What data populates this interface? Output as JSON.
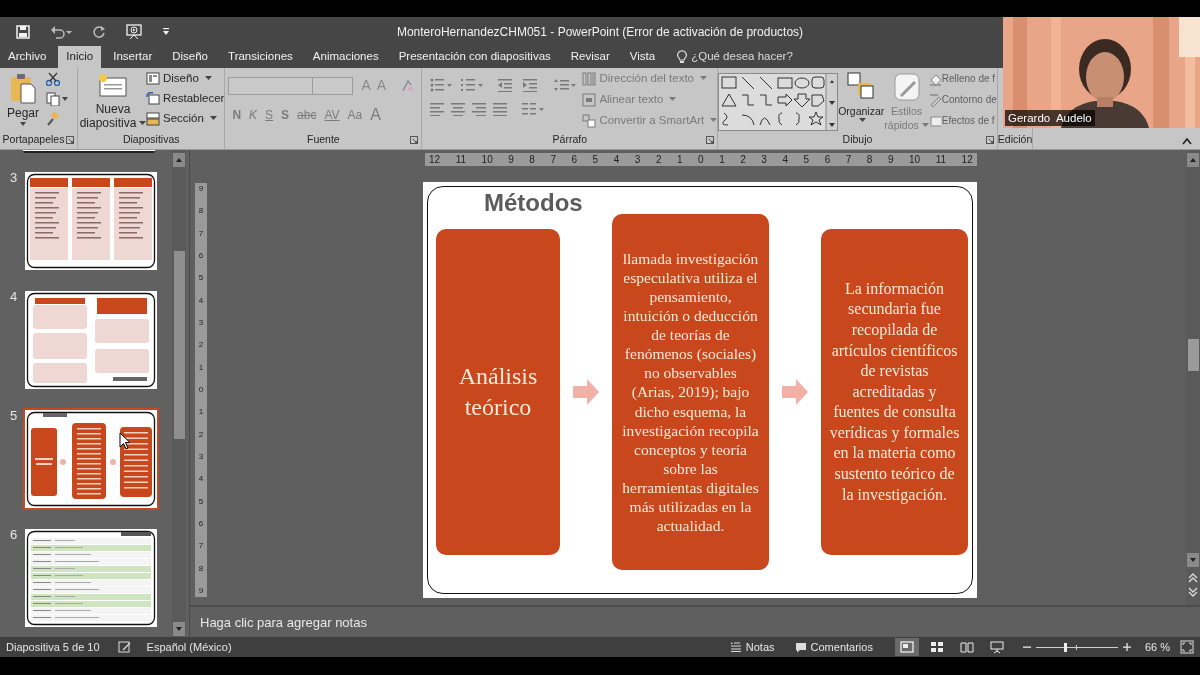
{
  "title_bar": {
    "title": "MonteroHernandezCHM051 - PowerPoint (Error de activación de productos)"
  },
  "tabs": [
    {
      "label": "Archivo",
      "selected": false
    },
    {
      "label": "Inicio",
      "selected": true
    },
    {
      "label": "Insertar",
      "selected": false
    },
    {
      "label": "Diseño",
      "selected": false
    },
    {
      "label": "Transiciones",
      "selected": false
    },
    {
      "label": "Animaciones",
      "selected": false
    },
    {
      "label": "Presentación con diapositivas",
      "selected": false
    },
    {
      "label": "Revisar",
      "selected": false
    },
    {
      "label": "Vista",
      "selected": false
    }
  ],
  "tell_me": {
    "placeholder": "¿Qué desea hacer?"
  },
  "ribbon": {
    "clipboard": {
      "label": "Portapapeles",
      "paste": "Pegar"
    },
    "slides": {
      "label": "Diapositivas",
      "new_slide": [
        "Nueva",
        "diapositiva"
      ],
      "buttons": [
        {
          "label": "Diseño",
          "kind": "layout"
        },
        {
          "label": "Restablecer",
          "kind": "reset"
        },
        {
          "label": "Sección",
          "kind": "section"
        }
      ]
    },
    "font": {
      "label": "Fuente",
      "size_buttons": [
        "A",
        "A"
      ],
      "format_buttons": [
        "N",
        "K",
        "S",
        "S",
        "abc",
        "AV",
        "Aa",
        "A"
      ]
    },
    "paragraph": {
      "label": "Párrafo",
      "buttons": [
        {
          "label": "Dirección del texto",
          "disabled": true
        },
        {
          "label": "Alinear texto",
          "disabled": true
        },
        {
          "label": "Convertir a SmartArt",
          "disabled": true
        }
      ]
    },
    "drawing": {
      "label": "Dibujo",
      "large_buttons": [
        {
          "label": "Organizar",
          "disabled": false
        },
        {
          "label": "Estilos",
          "sub": "rápidos",
          "disabled": true
        }
      ],
      "small_buttons": [
        {
          "label": "Relleno de f",
          "disabled": true
        },
        {
          "label": "Contorno de",
          "disabled": true
        },
        {
          "label": "Efectos de f",
          "disabled": true
        }
      ]
    },
    "editing": {
      "label": "Edición"
    }
  },
  "thumbnails": [
    {
      "number": "3",
      "kind": "three_columns",
      "selected": false
    },
    {
      "number": "4",
      "kind": "two_columns",
      "selected": false
    },
    {
      "number": "5",
      "kind": "methods",
      "selected": true
    },
    {
      "number": "6",
      "kind": "table",
      "selected": false
    }
  ],
  "rulers": {
    "horizontal": [
      "12",
      "11",
      "10",
      "9",
      "8",
      "7",
      "6",
      "5",
      "4",
      "3",
      "2",
      "1",
      "0",
      "1",
      "2",
      "3",
      "4",
      "5",
      "6",
      "7",
      "8",
      "9",
      "10",
      "11",
      "12"
    ],
    "vertical": [
      "9",
      "8",
      "7",
      "6",
      "5",
      "4",
      "3",
      "2",
      "1",
      "0",
      "1",
      "2",
      "3",
      "4",
      "5",
      "6",
      "7",
      "8",
      "9"
    ]
  },
  "slide": {
    "title": "Métodos",
    "boxes": [
      {
        "kind": "heading",
        "text": "Análisis teórico"
      },
      {
        "kind": "body",
        "text": "llamada investigación especulativa utiliza el pensamiento, intuición o deducción de teorías de fenómenos (sociales) no observables (Arias, 2019); bajo dicho esquema, la investigación recopila conceptos y teoría sobre las herramientas digitales más utilizadas en la actualidad."
      },
      {
        "kind": "body",
        "text": "La información secundaria fue recopilada de artículos científicos de revistas acreditadas y fuentes de consulta verídicas y formales en la materia como sustento teórico de la investigación."
      }
    ]
  },
  "notes": {
    "placeholder": "Haga clic para agregar notas"
  },
  "status_bar": {
    "slide_info": "Diapositiva 5 de 10",
    "language": "Español (México)",
    "notes": "Notas",
    "comments": "Comentarios",
    "views": [
      {
        "kind": "normal",
        "selected": true
      },
      {
        "kind": "sorter",
        "selected": false
      },
      {
        "kind": "reading",
        "selected": false
      },
      {
        "kind": "slideshow",
        "selected": false
      }
    ],
    "zoom": {
      "level": 0.35,
      "reading": "66 %"
    }
  },
  "webcam": {
    "name": "Gerardo  Audelo"
  }
}
